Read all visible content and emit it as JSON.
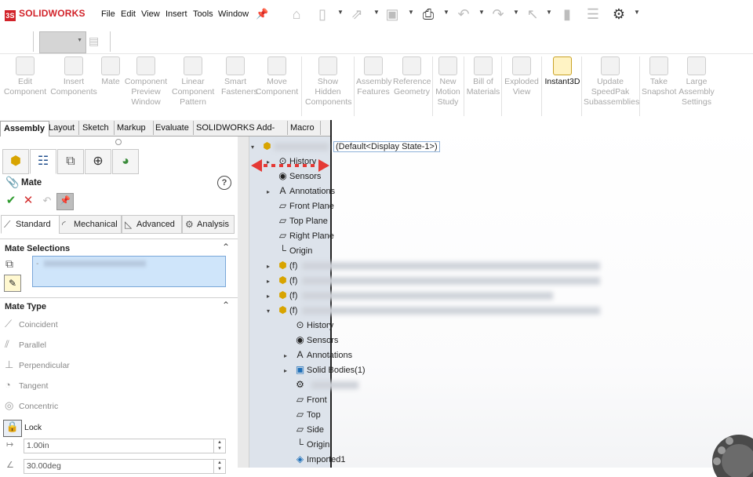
{
  "app": {
    "brand": "SOLIDWORKS"
  },
  "menu": [
    "File",
    "Edit",
    "View",
    "Insert",
    "Tools",
    "Window"
  ],
  "quick_icons": [
    "home-icon",
    "new-document-icon",
    "open-icon",
    "save-icon",
    "print-icon",
    "undo-icon",
    "redo-icon",
    "select-icon",
    "rebuild-icon",
    "options-list-icon",
    "gear-icon"
  ],
  "ribbon": [
    {
      "label": "Edit\nComponent",
      "icon": "edit-component-icon",
      "active": false
    },
    {
      "label": "Insert\nComponents",
      "icon": "insert-components-icon",
      "active": false
    },
    {
      "label": "Mate",
      "icon": "mate-icon",
      "active": false
    },
    {
      "label": "Component\nPreview\nWindow",
      "icon": "component-preview-icon",
      "active": false
    },
    {
      "label": "Linear\nComponent\nPattern",
      "icon": "linear-pattern-icon",
      "active": false
    },
    {
      "label": "Smart\nFasteners",
      "icon": "smart-fasteners-icon",
      "active": false
    },
    {
      "label": "Move\nComponent",
      "icon": "move-component-icon",
      "active": false
    },
    {
      "label": "Show\nHidden\nComponents",
      "icon": "show-hidden-icon",
      "active": false
    },
    {
      "label": "Assembly\nFeatures",
      "icon": "assembly-features-icon",
      "active": false
    },
    {
      "label": "Reference\nGeometry",
      "icon": "reference-geometry-icon",
      "active": false
    },
    {
      "label": "New\nMotion\nStudy",
      "icon": "motion-study-icon",
      "active": false
    },
    {
      "label": "Bill of\nMaterials",
      "icon": "bom-icon",
      "active": false
    },
    {
      "label": "Exploded\nView",
      "icon": "exploded-view-icon",
      "active": false
    },
    {
      "label": "Instant3D",
      "icon": "instant3d-icon",
      "active": true
    },
    {
      "label": "Update\nSpeedPak\nSubassemblies",
      "icon": "speedpak-icon",
      "active": false
    },
    {
      "label": "Take\nSnapshot",
      "icon": "snapshot-icon",
      "active": false
    },
    {
      "label": "Large\nAssembly\nSettings",
      "icon": "large-assembly-icon",
      "active": false
    }
  ],
  "tabs": [
    {
      "label": "Assembly",
      "active": true
    },
    {
      "label": "Layout",
      "active": false
    },
    {
      "label": "Sketch",
      "active": false
    },
    {
      "label": "Markup",
      "active": false
    },
    {
      "label": "Evaluate",
      "active": false
    },
    {
      "label": "SOLIDWORKS Add-Ins",
      "active": false
    },
    {
      "label": "Macro",
      "active": false
    }
  ],
  "property_manager": {
    "title": "Mate",
    "help": "?",
    "ok": "✔",
    "cancel": "✕",
    "subtabs": [
      "Standard",
      "Mechanical",
      "Advanced",
      "Analysis"
    ],
    "mate_selections": {
      "header": "Mate Selections",
      "items": [
        "-"
      ]
    },
    "mate_type": {
      "header": "Mate Type",
      "types": [
        "Coincident",
        "Parallel",
        "Perpendicular",
        "Tangent",
        "Concentric",
        "Lock"
      ]
    },
    "distance_value": "1.00in",
    "angle_value": "30.00deg"
  },
  "tree": {
    "root_state": "(Default<Display State-1>)",
    "items": [
      {
        "label": "History",
        "icon": "history-icon",
        "level": 1,
        "expand": "▸"
      },
      {
        "label": "Sensors",
        "icon": "sensors-icon",
        "level": 1,
        "expand": ""
      },
      {
        "label": "Annotations",
        "icon": "annotations-icon",
        "level": 1,
        "expand": "▸"
      },
      {
        "label": "Front Plane",
        "icon": "plane-icon",
        "level": 1,
        "expand": ""
      },
      {
        "label": "Top Plane",
        "icon": "plane-icon",
        "level": 1,
        "expand": ""
      },
      {
        "label": "Right Plane",
        "icon": "plane-icon",
        "level": 1,
        "expand": ""
      },
      {
        "label": "Origin",
        "icon": "origin-icon",
        "level": 1,
        "expand": ""
      },
      {
        "label": "(f)",
        "icon": "assembly-component-icon",
        "level": 1,
        "expand": "▸"
      },
      {
        "label": "(f)",
        "icon": "assembly-component-icon",
        "level": 1,
        "expand": "▸"
      },
      {
        "label": "(f)",
        "icon": "assembly-component-icon",
        "level": 1,
        "expand": "▸"
      },
      {
        "label": "(f)",
        "icon": "assembly-component-icon",
        "level": 1,
        "expand": "▾"
      },
      {
        "label": "History",
        "icon": "history-icon",
        "level": 2,
        "expand": ""
      },
      {
        "label": "Sensors",
        "icon": "sensors-icon",
        "level": 2,
        "expand": ""
      },
      {
        "label": "Annotations",
        "icon": "annotations-icon",
        "level": 2,
        "expand": "▸"
      },
      {
        "label": "Solid Bodies(1)",
        "icon": "solid-bodies-icon",
        "level": 2,
        "expand": "▸"
      },
      {
        "label": "",
        "icon": "material-icon",
        "level": 2,
        "expand": ""
      },
      {
        "label": "Front",
        "icon": "plane-icon",
        "level": 2,
        "expand": ""
      },
      {
        "label": "Top",
        "icon": "plane-icon",
        "level": 2,
        "expand": ""
      },
      {
        "label": "Side",
        "icon": "plane-icon",
        "level": 2,
        "expand": ""
      },
      {
        "label": "Origin",
        "icon": "origin-icon",
        "level": 2,
        "expand": ""
      },
      {
        "label": "Imported1",
        "icon": "imported-body-icon",
        "level": 2,
        "expand": ""
      }
    ]
  },
  "colors": {
    "brand_red": "#d2232a",
    "selection_blue": "#cfe5fa",
    "drag_arrow_red": "#e53935",
    "tree_bg": "#dde3eb"
  }
}
